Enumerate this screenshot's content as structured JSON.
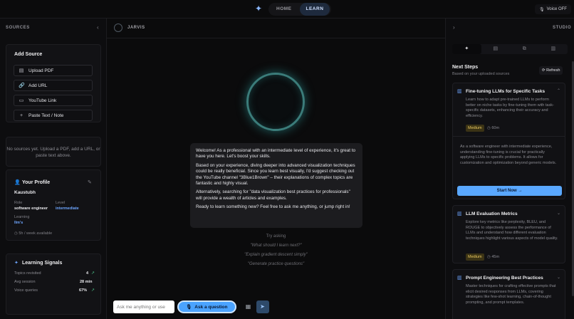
{
  "header": {
    "logo_icon": "sparkle-icon",
    "nav": [
      "HOME",
      "LEARN"
    ],
    "active_nav": "LEARN",
    "voice_label": "Voice OFF"
  },
  "sources": {
    "title": "SOURCES",
    "add_source": {
      "title": "Add Source",
      "buttons": [
        {
          "label": "Upload PDF",
          "icon": "document-icon"
        },
        {
          "label": "Add URL",
          "icon": "link-icon"
        },
        {
          "label": "YouTube Link",
          "icon": "video-icon"
        },
        {
          "label": "Paste Text / Note",
          "icon": "plus-icon"
        }
      ]
    },
    "empty_text": "No sources yet. Upload a PDF, add a URL, or paste text above."
  },
  "profile": {
    "title": "Your Profile",
    "name": "Kaustubh",
    "role_label": "Role",
    "role_value": "software engineer",
    "level_label": "Level",
    "level_value": "intermediate",
    "learning_label": "Learning",
    "learning_value": "llm's",
    "availability": "5h / week available"
  },
  "signals": {
    "title": "Learning Signals",
    "rows": [
      {
        "label": "Topics revisited",
        "value": "4"
      },
      {
        "label": "Avg session",
        "value": "28 min"
      },
      {
        "label": "Voice queries",
        "value": "67%"
      }
    ]
  },
  "chat": {
    "agent_name": "JARVIS",
    "message": [
      "Welcome! As a professional with an intermediate level of experience, it's great to have you here. Let's boost your skills.",
      "Based on your experience, diving deeper into advanced visualization techniques could be really beneficial. Since you learn best visually, I'd suggest checking out the YouTube channel \"3Blue1Brown\" – their explanations of complex topics are fantastic and highly visual.",
      "Alternatively, searching for \"data visualization best practices for professionals\" will provide a wealth of articles and examples.",
      "Ready to learn something new? Feel free to ask me anything, or jump right in!"
    ],
    "try_asking": "Try asking",
    "suggestions": [
      "\"What should I learn next?\"",
      "\"Explain gradient descent simply\"",
      "\"Generate practice questions\""
    ],
    "input_placeholder": "Ask me anything or use",
    "ask_button": "Ask a question"
  },
  "studio": {
    "title": "STUDIO",
    "tabs": [
      "✦",
      "▤",
      "⧉",
      "▥"
    ],
    "next_steps_title": "Next Steps",
    "next_steps_sub": "Based on your uploaded sources",
    "refresh_label": "Refresh",
    "steps": [
      {
        "title": "Fine-tuning LLMs for Specific Tasks",
        "desc": "Learn how to adapt pre-trained LLMs to perform better on niche tasks by fine-tuning them with task-specific datasets, enhancing their accuracy and efficiency.",
        "difficulty": "Medium",
        "duration": "60m",
        "detail": "As a software engineer with intermediate experience, understanding fine-tuning is crucial for practically applying LLMs to specific problems. It allows for customization and optimization beyond generic models.",
        "start_label": "Start Now →"
      },
      {
        "title": "LLM Evaluation Metrics",
        "desc": "Explore key metrics like perplexity, BLEU, and ROUGE to objectively assess the performance of LLMs and understand how different evaluation techniques highlight various aspects of model quality.",
        "difficulty": "Medium",
        "duration": "45m"
      },
      {
        "title": "Prompt Engineering Best Practices",
        "desc": "Master techniques for crafting effective prompts that elicit desired responses from LLMs, covering strategies like few-shot learning, chain-of-thought prompting, and prompt templates."
      }
    ]
  }
}
